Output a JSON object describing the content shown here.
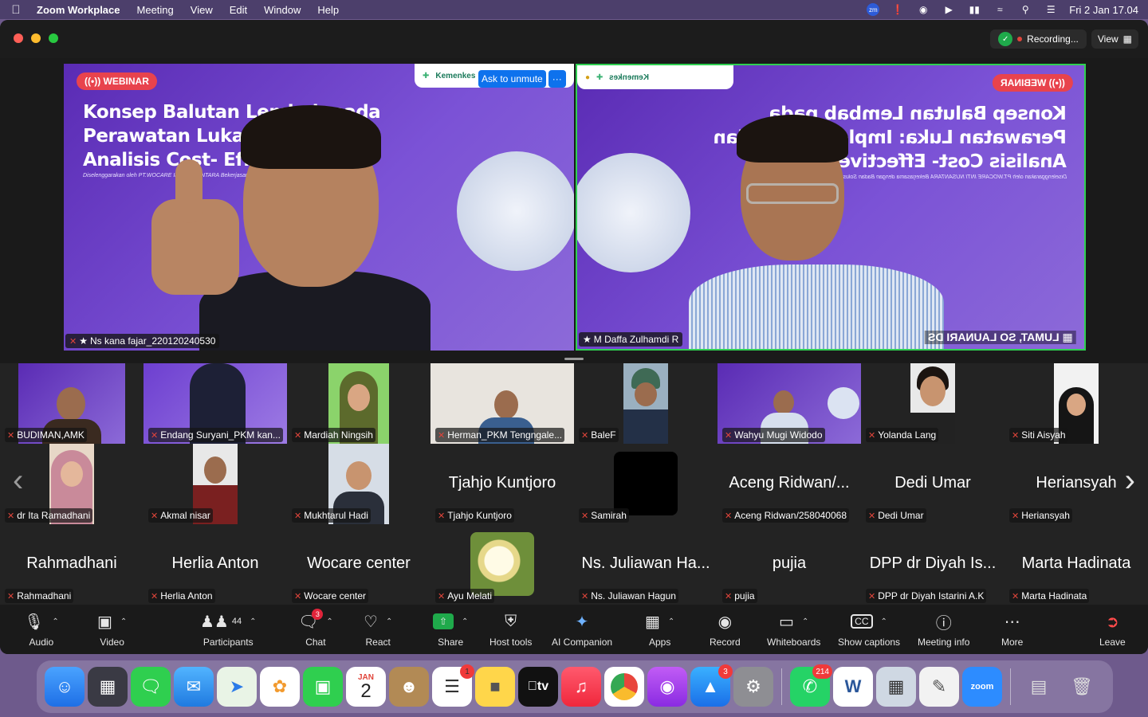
{
  "menubar": {
    "app": "Zoom Workplace",
    "items": [
      "Meeting",
      "View",
      "Edit",
      "Window",
      "Help"
    ],
    "clock": "Fri 2 Jan  17.04",
    "zoom_badge": "zm"
  },
  "titlebar": {
    "recording": "Recording...",
    "view": "View"
  },
  "stage": {
    "left": {
      "webinar_label": "WEBINAR",
      "slide_title_lines": [
        "Konsep Balutan Lembab pada",
        "Perawatan Luka: Impleme",
        "Analisis Cost- Effective"
      ],
      "slide_sub": "Diselenggarakan oleh PT.WOCARE INTI NUSANTARA Bekerjasama d",
      "logo_text": "Kemenkes",
      "name": "Ns kana fajar_220120240530"
    },
    "right": {
      "webinar_label": "WEBINAR",
      "slide_title_lines": [
        "Konsep Balutan Lembab pada",
        "Perawatan Luka: Implementasi dan",
        "Analisis Cost- Effective"
      ],
      "slide_sub": "Diselenggarakan oleh PT.WOCARE INTI NUSANTARA Bekerjasama dengan Badan Solusi Medikal Event",
      "logo_text": "Kemenkes",
      "name": "M Daffa Zulhamdi R",
      "mirrored_label": "LUMAT, SO LAUNARI DS"
    },
    "ask_unmute": "Ask to unmute",
    "more": "···"
  },
  "gallery": {
    "row1": [
      {
        "name": "BUDIMAN,AMK"
      },
      {
        "name": "Endang Suryani_PKM kan..."
      },
      {
        "name": "Mardiah Ningsih"
      },
      {
        "name": "Herman_PKM Tengngale..."
      },
      {
        "name": "BaleF"
      },
      {
        "name": "Wahyu Mugi Widodo"
      },
      {
        "name": "Yolanda Lang"
      },
      {
        "name": "Siti Aisyah"
      }
    ],
    "row2": [
      {
        "name": "dr Ita Ramadhani"
      },
      {
        "name": "Akmal nisar"
      },
      {
        "name": "Mukhtarul Hadi"
      },
      {
        "name": "Tjahjo Kuntjoro",
        "big": "Tjahjo Kuntjoro"
      },
      {
        "name": "Samirah"
      },
      {
        "name": "Aceng Ridwan/258040068",
        "big": "Aceng Ridwan/..."
      },
      {
        "name": "Dedi Umar",
        "big": "Dedi Umar"
      },
      {
        "name": "Heriansyah",
        "big": "Heriansyah"
      }
    ],
    "row3": [
      {
        "name": "Rahmadhani",
        "big": "Rahmadhani"
      },
      {
        "name": "Herlia Anton",
        "big": "Herlia Anton"
      },
      {
        "name": "Wocare center",
        "big": "Wocare center"
      },
      {
        "name": "Ayu Melati"
      },
      {
        "name": "Ns. Juliawan Hagun",
        "big": "Ns. Juliawan Ha..."
      },
      {
        "name": "pujia",
        "big": "pujia"
      },
      {
        "name": "DPP dr Diyah Istarini A.K",
        "big": "DPP dr Diyah Is..."
      },
      {
        "name": "Marta Hadinata",
        "big": "Marta Hadinata"
      }
    ]
  },
  "toolbar": {
    "audio": "Audio",
    "video": "Video",
    "participants": "Participants",
    "participants_count": "44",
    "chat": "Chat",
    "chat_badge": "3",
    "react": "React",
    "share": "Share",
    "host_tools": "Host tools",
    "ai_companion": "AI Companion",
    "apps": "Apps",
    "record": "Record",
    "whiteboards": "Whiteboards",
    "show_captions": "Show captions",
    "meeting_info": "Meeting info",
    "more": "More",
    "leave": "Leave"
  },
  "dock": {
    "calendar_month": "JAN",
    "calendar_day": "2",
    "reminders_badge": "1",
    "appstore_badge": "3",
    "whatsapp_badge": "214",
    "tv_label": "tv",
    "zoom_label": "zoom",
    "word_label": "W"
  },
  "colors": {
    "accent_blue": "#0e72ed",
    "active_speaker": "#2fd051",
    "muted_red": "#e0453b",
    "share_green": "#1faa4b"
  }
}
